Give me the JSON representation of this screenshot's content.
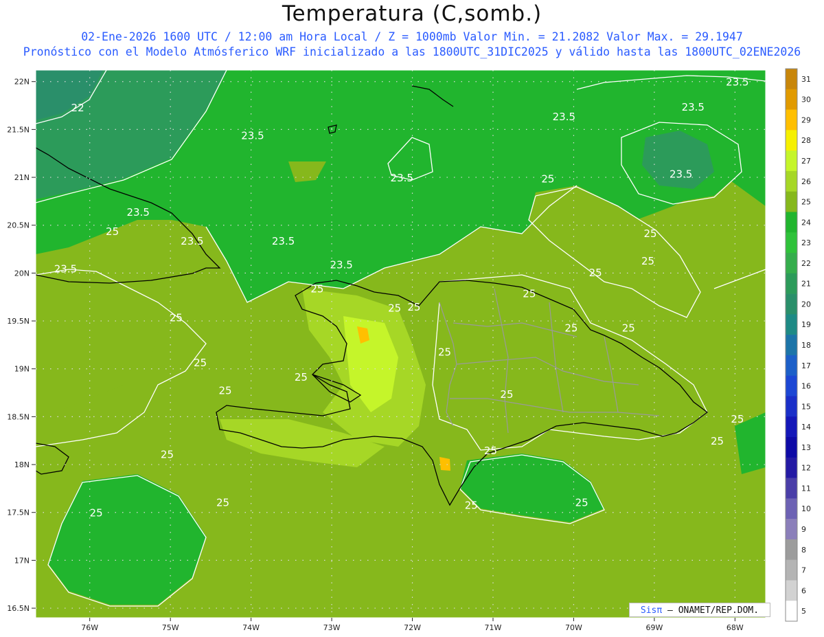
{
  "header": {
    "title": "Temperatura (C,somb.)",
    "subtitle_line1": "02-Ene-2026 1600 UTC / 12:00 am Hora Local / Z = 1000mb  Valor Min. = 21.2082  Valor Max. = 29.1947",
    "subtitle_line2": "Pronóstico con el Modelo Atmósferico WRF inicializado a las 1800UTC_31DIC2025 y válido hasta las  1800UTC_02ENE2026"
  },
  "axes": {
    "lat_labels": [
      "22N",
      "21.5N",
      "21N",
      "20.5N",
      "20N",
      "19.5N",
      "19N",
      "18.5N",
      "18N",
      "17.5N",
      "17N",
      "16.5N"
    ],
    "lat_values": [
      22,
      21.5,
      21,
      20.5,
      20,
      19.5,
      19,
      18.5,
      18,
      17.5,
      17,
      16.5
    ],
    "lon_labels": [
      "76W",
      "75W",
      "74W",
      "73W",
      "72W",
      "71W",
      "70W",
      "69W",
      "68W"
    ],
    "lon_values": [
      -76,
      -75,
      -74,
      -73,
      -72,
      -71,
      -70,
      -69,
      -68
    ]
  },
  "colorbar": {
    "labels": [
      "31",
      "30",
      "29",
      "28",
      "27",
      "26",
      "25",
      "24",
      "23",
      "22",
      "21",
      "20",
      "19",
      "18",
      "17",
      "16",
      "15",
      "14",
      "13",
      "12",
      "11",
      "10",
      "9",
      "8",
      "7",
      "6",
      "5"
    ],
    "colors": [
      "#c8860a",
      "#e19a00",
      "#ffbf00",
      "#f6f000",
      "#c5f52a",
      "#a6d726",
      "#86b81c",
      "#21b52e",
      "#2fc23a",
      "#35ad4c",
      "#2c9b5a",
      "#2a8f6a",
      "#1e8a85",
      "#1c74a8",
      "#1c5fc8",
      "#1c47d4",
      "#1a2fc8",
      "#1417b8",
      "#0e0aa6",
      "#241aa4",
      "#4a3ea8",
      "#6d62b4",
      "#8b7fba",
      "#9c9c9c",
      "#b4b4b4",
      "#d2d2d2",
      "#ffffff"
    ]
  },
  "contour_labels": [
    {
      "text": "22",
      "lon": -76.15,
      "lat": 21.72
    },
    {
      "text": "23.5",
      "lon": -73.98,
      "lat": 21.43
    },
    {
      "text": "23.5",
      "lon": -72.13,
      "lat": 20.99
    },
    {
      "text": "23.5",
      "lon": -70.12,
      "lat": 21.63
    },
    {
      "text": "23.5",
      "lon": -67.97,
      "lat": 21.99
    },
    {
      "text": "23.5",
      "lon": -68.52,
      "lat": 21.73
    },
    {
      "text": "23.5",
      "lon": -68.67,
      "lat": 21.03
    },
    {
      "text": "23.5",
      "lon": -75.4,
      "lat": 20.63
    },
    {
      "text": "23.5",
      "lon": -74.73,
      "lat": 20.33
    },
    {
      "text": "23.5",
      "lon": -73.6,
      "lat": 20.33
    },
    {
      "text": "23.5",
      "lon": -76.3,
      "lat": 20.04
    },
    {
      "text": "23.5",
      "lon": -72.88,
      "lat": 20.08
    },
    {
      "text": "25",
      "lon": -75.72,
      "lat": 20.43
    },
    {
      "text": "25",
      "lon": -74.93,
      "lat": 19.53
    },
    {
      "text": "25",
      "lon": -73.18,
      "lat": 19.83
    },
    {
      "text": "25",
      "lon": -72.22,
      "lat": 19.63
    },
    {
      "text": "25",
      "lon": -71.98,
      "lat": 19.64
    },
    {
      "text": "25",
      "lon": -70.55,
      "lat": 19.78
    },
    {
      "text": "25",
      "lon": -70.03,
      "lat": 19.42
    },
    {
      "text": "25",
      "lon": -69.32,
      "lat": 19.42
    },
    {
      "text": "25",
      "lon": -70.32,
      "lat": 20.98
    },
    {
      "text": "25",
      "lon": -69.05,
      "lat": 20.41
    },
    {
      "text": "25",
      "lon": -69.08,
      "lat": 20.12
    },
    {
      "text": "25",
      "lon": -69.73,
      "lat": 20.0
    },
    {
      "text": "25",
      "lon": -71.6,
      "lat": 19.17
    },
    {
      "text": "25",
      "lon": -74.63,
      "lat": 19.06
    },
    {
      "text": "25",
      "lon": -73.38,
      "lat": 18.91
    },
    {
      "text": "25",
      "lon": -74.32,
      "lat": 18.77
    },
    {
      "text": "25",
      "lon": -70.83,
      "lat": 18.73
    },
    {
      "text": "25",
      "lon": -67.97,
      "lat": 18.47
    },
    {
      "text": "25",
      "lon": -68.22,
      "lat": 18.24
    },
    {
      "text": "25",
      "lon": -75.04,
      "lat": 18.1
    },
    {
      "text": "25",
      "lon": -71.03,
      "lat": 18.14
    },
    {
      "text": "25",
      "lon": -71.27,
      "lat": 17.57
    },
    {
      "text": "25",
      "lon": -69.9,
      "lat": 17.6
    },
    {
      "text": "25",
      "lon": -74.35,
      "lat": 17.6
    },
    {
      "text": "25",
      "lon": -75.92,
      "lat": 17.49
    }
  ],
  "credit": {
    "brand": "Sisπ",
    "org": "ONAMET/REP.DOM."
  }
}
